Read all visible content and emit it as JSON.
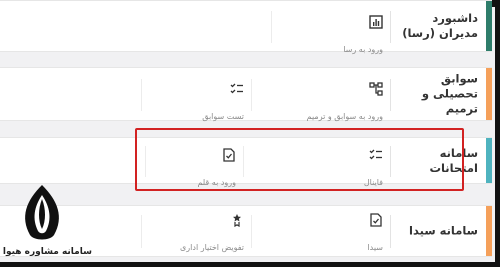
{
  "colors": {
    "accent_green": "#2e7d6b",
    "accent_orange": "#f5a05a",
    "accent_teal": "#4fb3bf",
    "highlight_red": "#d22222"
  },
  "cards": [
    {
      "title": "داشبورد مدیران (رسا)",
      "actions": [
        {
          "icon": "bar-chart-icon",
          "label": "ورود به رسا"
        }
      ]
    },
    {
      "title": "سوابق تحصیلی و ترمیم",
      "actions": [
        {
          "icon": "sitemap-icon",
          "label": "ورود به سوابق و ترمیم"
        },
        {
          "icon": "checklist-icon",
          "label": "تست سوابق"
        }
      ]
    },
    {
      "title": "سامانه امتحانات",
      "actions": [
        {
          "icon": "checklist-icon",
          "label": "فاینال"
        },
        {
          "icon": "document-check-icon",
          "label": "ورود به قلم"
        }
      ]
    },
    {
      "title": "سامانه سیدا",
      "actions": [
        {
          "icon": "document-check-icon",
          "label": "سیدا"
        },
        {
          "icon": "medal-icon",
          "label": "تفویض اختیار اداری"
        }
      ]
    }
  ],
  "logo": {
    "caption": "سامانه مشاوره هیوا"
  }
}
